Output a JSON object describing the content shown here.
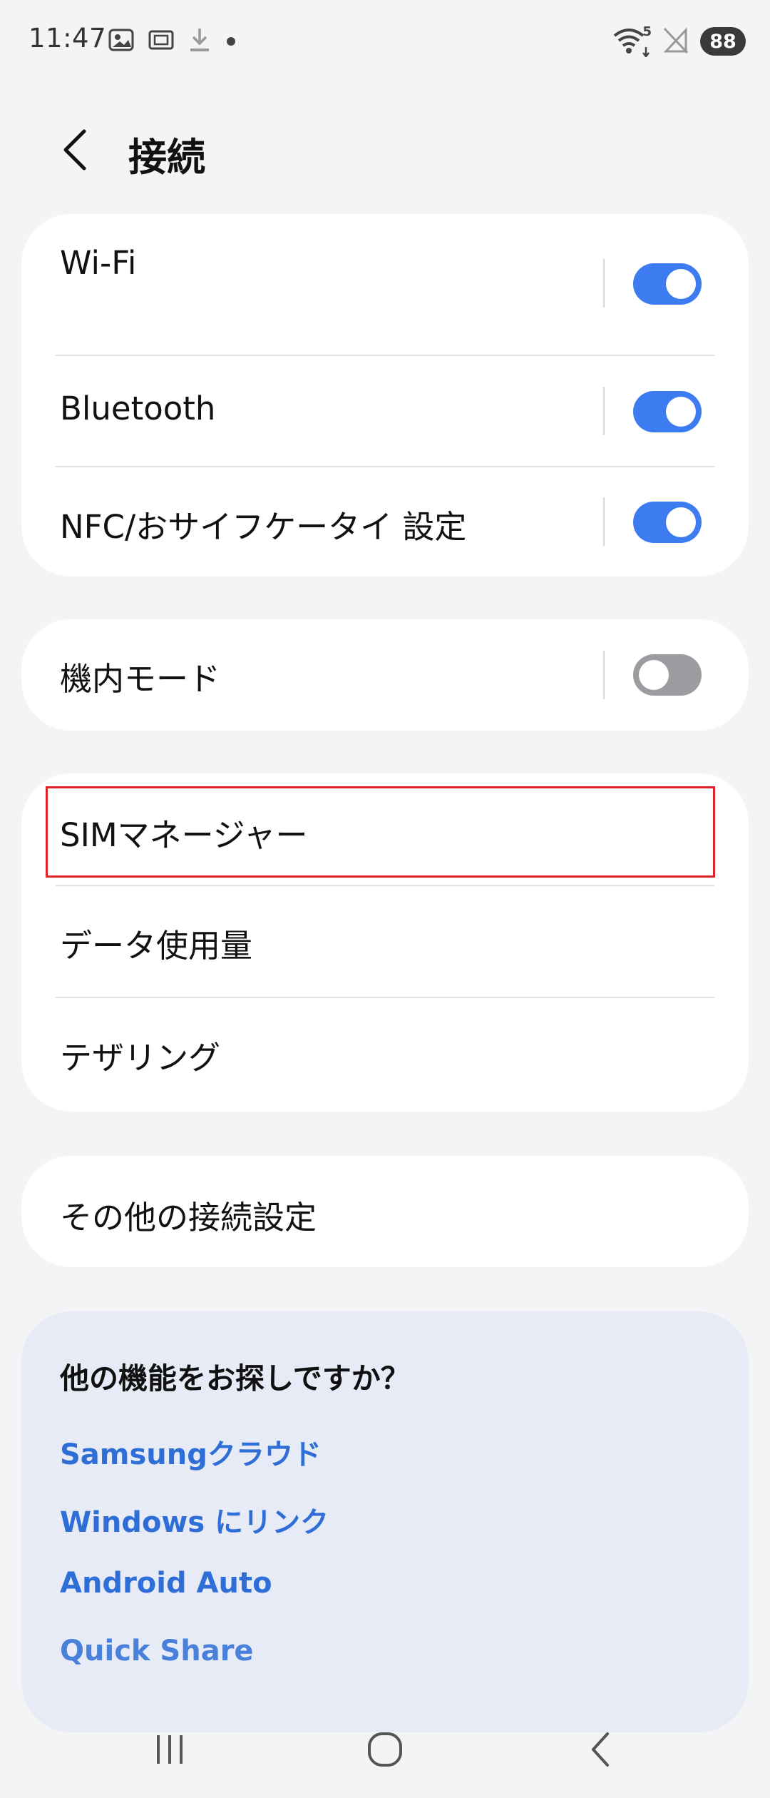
{
  "status_bar": {
    "time": "11:47",
    "network_label": "5",
    "battery": "88",
    "left_icons": [
      "screenshot-icon",
      "media-icon",
      "download-icon",
      "dot-icon"
    ],
    "right_icons": [
      "wifi-icon",
      "no-signal-icon",
      "battery-icon"
    ]
  },
  "header": {
    "title": "接続",
    "back_icon": "chevron-left-icon"
  },
  "group1": {
    "items": [
      {
        "label": "Wi-Fi",
        "toggle": true
      },
      {
        "label": "Bluetooth",
        "toggle": true
      },
      {
        "label": "NFC/おサイフケータイ 設定",
        "toggle": true
      }
    ]
  },
  "group2": {
    "items": [
      {
        "label": "機内モード",
        "toggle": false
      }
    ]
  },
  "group3": {
    "items": [
      {
        "label": "SIMマネージャー"
      },
      {
        "label": "データ使用量"
      },
      {
        "label": "テザリング"
      }
    ]
  },
  "group4": {
    "items": [
      {
        "label": "その他の接続設定"
      }
    ]
  },
  "suggestions": {
    "title": "他の機能をお探しですか？",
    "links": [
      {
        "label": "Samsungクラウド"
      },
      {
        "label": "Windows にリンク"
      },
      {
        "label": "Android Auto"
      },
      {
        "label": "Quick Share"
      }
    ]
  },
  "navbar": {
    "icons": [
      "recents-icon",
      "home-icon",
      "back-icon"
    ]
  },
  "colors": {
    "background": "#f4f4f6",
    "card": "#ffffff",
    "toggle_on": "#3c7cf0",
    "toggle_off": "#9b9ba0",
    "link": "#2e6ed6",
    "suggest_bg": "#e6ebf6",
    "highlight": "#e0202a"
  }
}
